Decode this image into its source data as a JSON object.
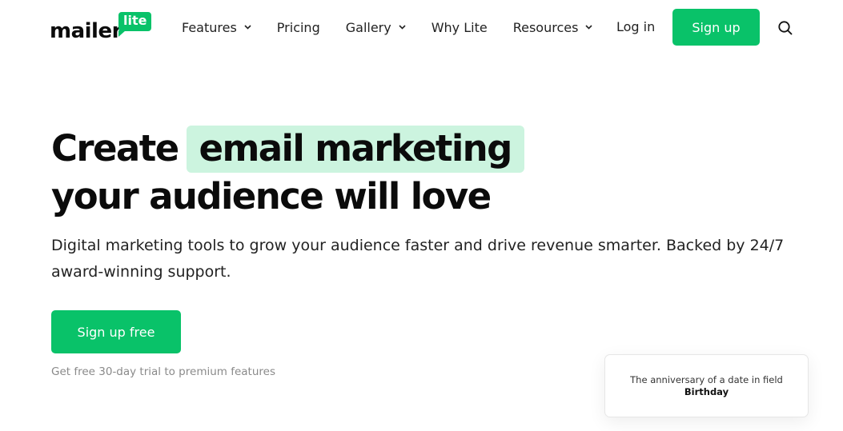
{
  "brand": {
    "word": "mailer",
    "badge": "lite",
    "accent_color": "#09c269",
    "highlight_color": "#ccf4df"
  },
  "nav": {
    "items": [
      {
        "label": "Features",
        "dropdown": true
      },
      {
        "label": "Pricing",
        "dropdown": false
      },
      {
        "label": "Gallery",
        "dropdown": true
      },
      {
        "label": "Why Lite",
        "dropdown": false
      },
      {
        "label": "Resources",
        "dropdown": true
      }
    ],
    "login_label": "Log in",
    "signup_label": "Sign up",
    "search_icon": "search-icon",
    "chevron_icon": "chevron-down-icon"
  },
  "hero": {
    "headline_start": "Create",
    "headline_highlight": "email marketing",
    "headline_line2": "your audience will love",
    "subtext": "Digital marketing tools to grow your audience faster and drive revenue smarter. Backed by 24/7 award-winning support.",
    "cta_label": "Sign up free",
    "trial_note": "Get free 30-day trial to premium features"
  },
  "card": {
    "text_prefix": "The anniversary of a date in field",
    "text_bold": "Birthday"
  }
}
